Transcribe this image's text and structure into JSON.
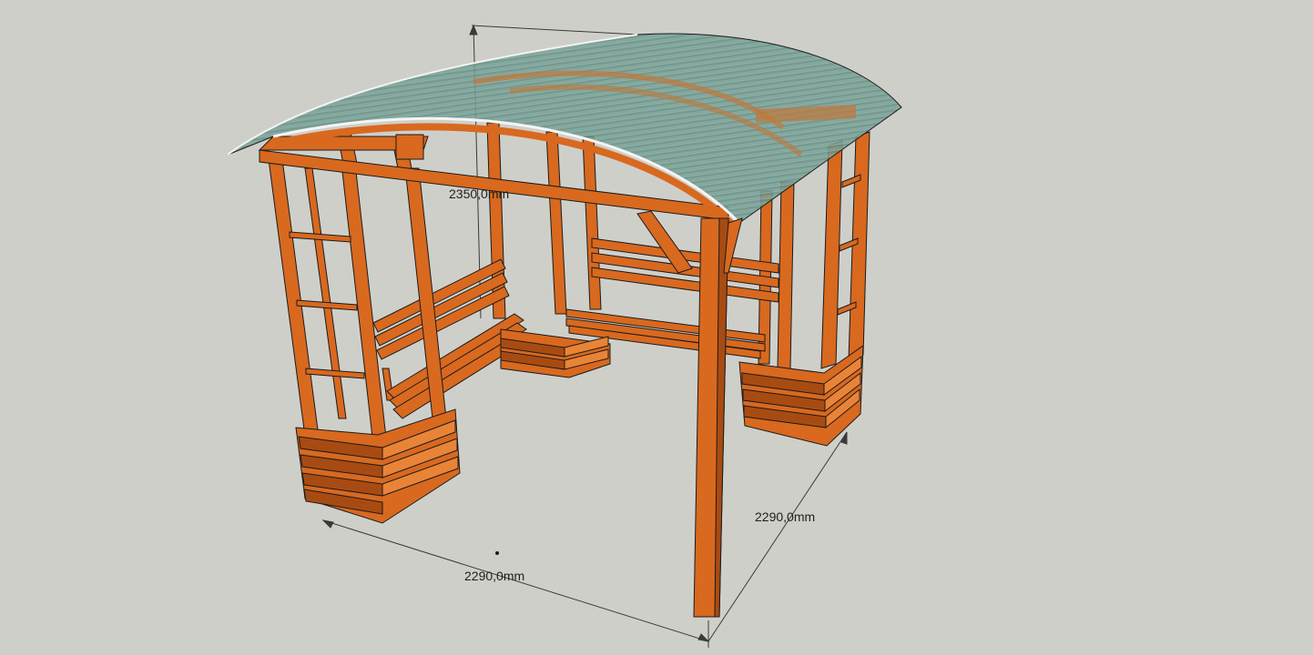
{
  "viewport": {
    "background": "#cfcfca"
  },
  "colors": {
    "wood": "#d8691f",
    "wood_dark": "#a84b12",
    "wood_light": "#e98437",
    "edge": "#1b1b1b",
    "roof_glass": "#6f9a90",
    "dimension_line": "#3a3a3a"
  },
  "dimensions": {
    "height": "2350,0mm",
    "width": "2290,0mm",
    "depth": "2290,0mm"
  }
}
